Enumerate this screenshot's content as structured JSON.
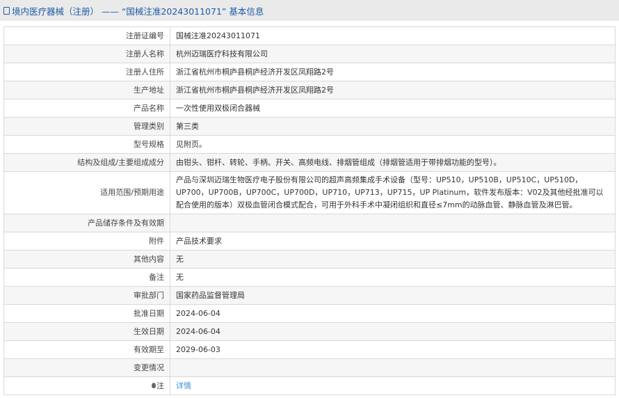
{
  "header": {
    "title": "境内医疗器械（注册） —— “国械注准20243011071” 基本信息"
  },
  "rows": [
    {
      "label": "注册证编号",
      "value": "国械注准20243011071"
    },
    {
      "label": "注册人名称",
      "value": "杭州迈瑞医疗科技有限公司"
    },
    {
      "label": "注册人住所",
      "value": "浙江省杭州市桐庐县桐庐经济开发区凤翔路2号"
    },
    {
      "label": "生产地址",
      "value": "浙江省杭州市桐庐县桐庐经济开发区凤翔路2号"
    },
    {
      "label": "产品名称",
      "value": "一次性使用双极闭合器械"
    },
    {
      "label": "管理类别",
      "value": "第三类"
    },
    {
      "label": "型号规格",
      "value": "见附页。"
    },
    {
      "label": "结构及组成/主要组成成分",
      "value": "由钳头、钳杆、转轮、手柄、开关、高频电线、排烟管组成（排烟管适用于带排烟功能的型号）。"
    },
    {
      "label": "适用范围/预期用途",
      "value": "产品与深圳迈瑞生物医疗电子股份有限公司的超声高频集成手术设备（型号：UP510，UP510B，UP510C，UP510D，UP700，UP700B，UP700C，UP700D，UP710，UP713，UP715，UP Platinum，软件发布版本：V02及其他经批准可以配合使用的版本）双极血管闭合模式配合，可用于外科手术中凝闭组织和直径≤7mm的动脉血管、静脉血管及淋巴管。"
    },
    {
      "label": "产品储存条件及有效期",
      "value": ""
    },
    {
      "label": "附件",
      "value": "产品技术要求"
    },
    {
      "label": "其他内容",
      "value": "无"
    },
    {
      "label": "备注",
      "value": "无"
    },
    {
      "label": "审批部门",
      "value": "国家药品监督管理局"
    },
    {
      "label": "批准日期",
      "value": "2024-06-04"
    },
    {
      "label": "生效日期",
      "value": "2024-06-04"
    },
    {
      "label": "有效期至",
      "value": "2029-06-03"
    },
    {
      "label": "变更情况",
      "value": ""
    }
  ],
  "note": {
    "label": "注",
    "link": "详情"
  }
}
